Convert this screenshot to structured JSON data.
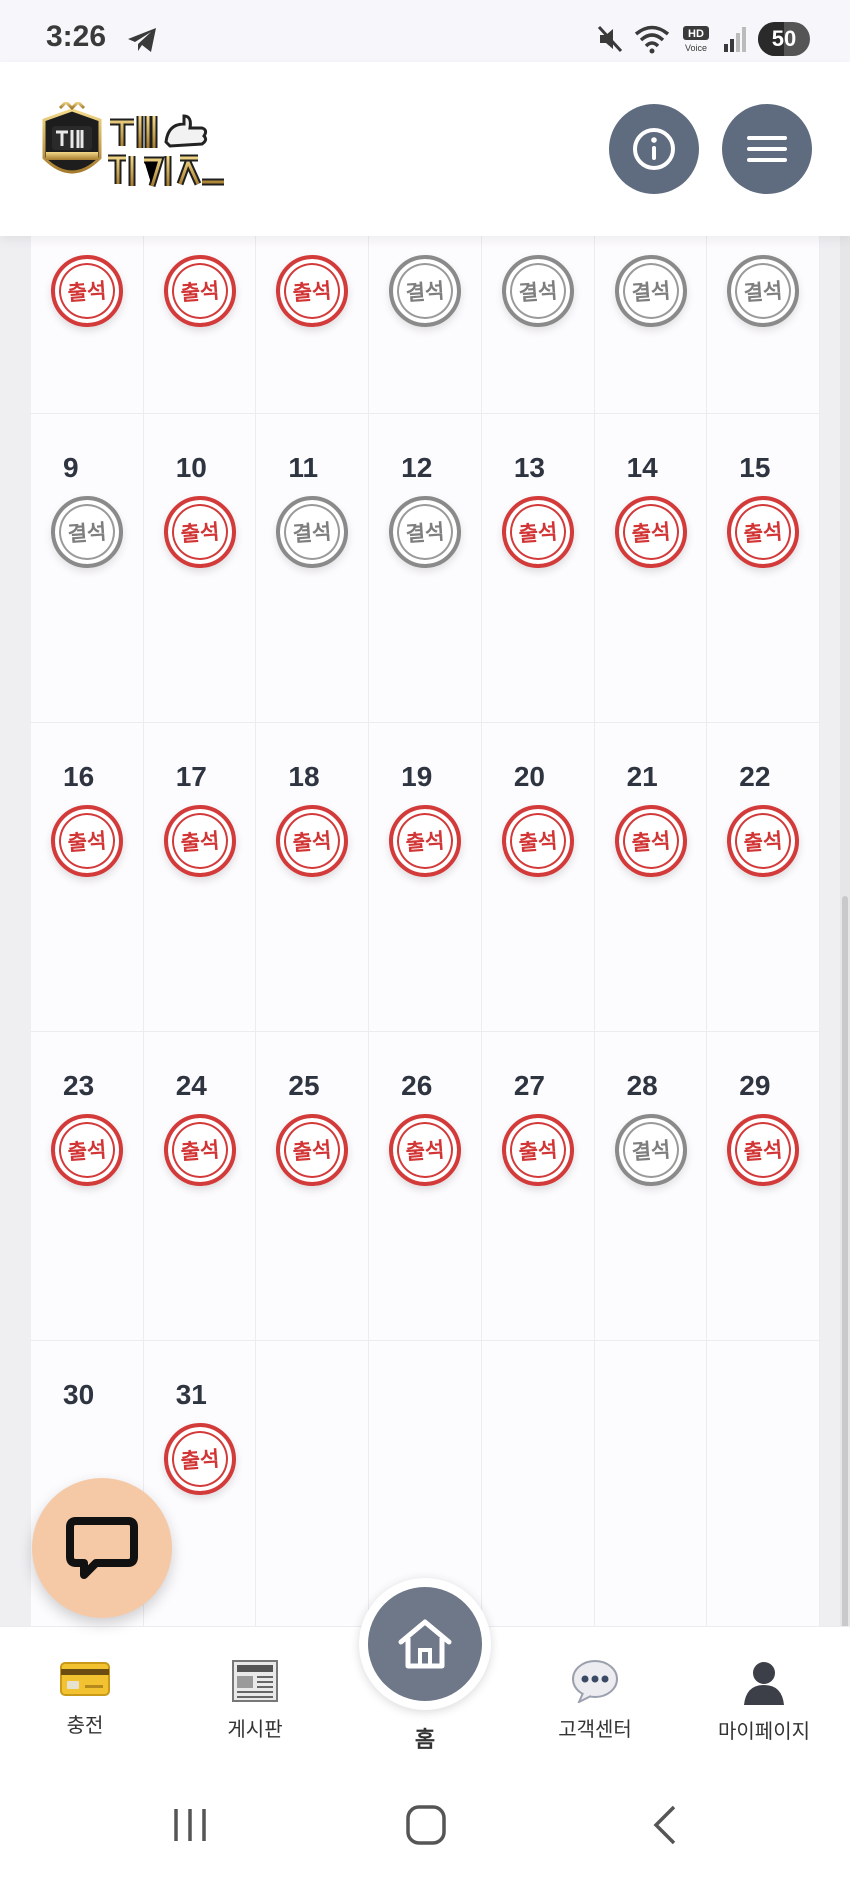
{
  "status_bar": {
    "time": "3:26",
    "battery": "50",
    "icons": [
      "telegram-icon",
      "mute-icon",
      "wifi-icon",
      "hd-voice-icon",
      "signal-icon",
      "battery-icon"
    ]
  },
  "header": {
    "logo_alt": "찐 카지노",
    "info_button_icon": "info-icon",
    "menu_button_icon": "hamburger-menu-icon"
  },
  "calendar": {
    "first_row_stamps": [
      "출석",
      "출석",
      "출석",
      "결석",
      "결석",
      "결석",
      "결석"
    ],
    "weeks": [
      [
        {
          "day": "9",
          "stamp": "결석"
        },
        {
          "day": "10",
          "stamp": "출석"
        },
        {
          "day": "11",
          "stamp": "결석"
        },
        {
          "day": "12",
          "stamp": "결석"
        },
        {
          "day": "13",
          "stamp": "출석"
        },
        {
          "day": "14",
          "stamp": "출석"
        },
        {
          "day": "15",
          "stamp": "출석"
        }
      ],
      [
        {
          "day": "16",
          "stamp": "출석"
        },
        {
          "day": "17",
          "stamp": "출석"
        },
        {
          "day": "18",
          "stamp": "출석"
        },
        {
          "day": "19",
          "stamp": "출석"
        },
        {
          "day": "20",
          "stamp": "출석"
        },
        {
          "day": "21",
          "stamp": "출석"
        },
        {
          "day": "22",
          "stamp": "출석"
        }
      ],
      [
        {
          "day": "23",
          "stamp": "출석"
        },
        {
          "day": "24",
          "stamp": "출석"
        },
        {
          "day": "25",
          "stamp": "출석"
        },
        {
          "day": "26",
          "stamp": "출석"
        },
        {
          "day": "27",
          "stamp": "출석"
        },
        {
          "day": "28",
          "stamp": "결석"
        },
        {
          "day": "29",
          "stamp": "출석"
        }
      ],
      [
        {
          "day": "30",
          "stamp": ""
        },
        {
          "day": "31",
          "stamp": "출석"
        },
        {
          "day": "",
          "stamp": ""
        },
        {
          "day": "",
          "stamp": ""
        },
        {
          "day": "",
          "stamp": ""
        },
        {
          "day": "",
          "stamp": ""
        },
        {
          "day": "",
          "stamp": ""
        }
      ]
    ],
    "present_label": "출석",
    "absent_label": "결석",
    "colors": {
      "present": "#d33a3a",
      "absent": "#8a8a8a"
    }
  },
  "chat_fab": {
    "icon": "chat-bubble-icon"
  },
  "bottom_nav": {
    "charge": "충전",
    "board": "게시판",
    "home": "홈",
    "support": "고객센터",
    "mypage": "마이페이지"
  },
  "system_nav": {
    "icons": [
      "recent-apps-icon",
      "home-circle-icon",
      "back-icon"
    ]
  }
}
